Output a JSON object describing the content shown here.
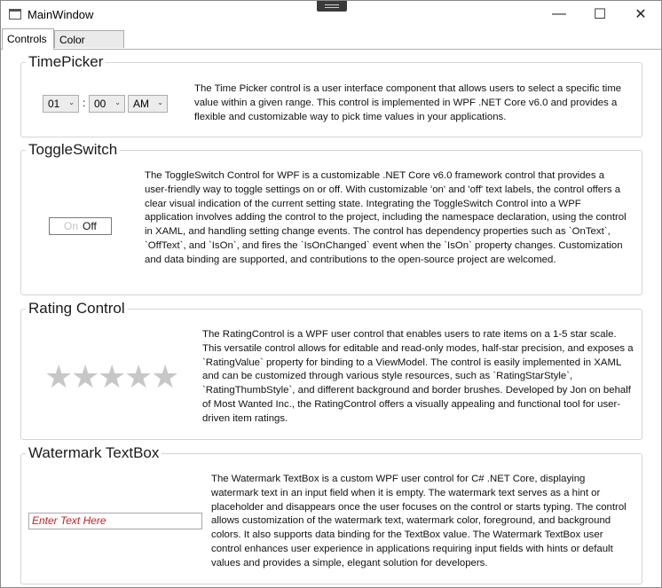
{
  "window": {
    "title": "MainWindow",
    "min_glyph": "—",
    "max_glyph": "☐",
    "close_glyph": "✕"
  },
  "tabs": [
    {
      "label": "Controls",
      "active": true
    },
    {
      "label": "Color Pickers",
      "active": false
    }
  ],
  "timepicker": {
    "title": "TimePicker",
    "hour": "01",
    "minute": "00",
    "ampm": "AM",
    "separator": ":",
    "description": "The Time Picker control is a user interface component that allows users to select a specific time value within a given range. This control is implemented in WPF .NET Core v6.0 and provides a flexible and customizable way to pick time values in your applications."
  },
  "toggleswitch": {
    "title": "ToggleSwitch",
    "on_label": "On",
    "off_label": "Off",
    "description": "The ToggleSwitch Control for WPF is a customizable .NET Core v6.0 framework control that provides a user-friendly way to toggle settings on or off. With customizable 'on' and 'off' text labels, the control offers a clear visual indication of the current setting state. Integrating the ToggleSwitch Control into a WPF application involves adding the control to the project, including the namespace declaration, using the control in XAML, and handling setting change events. The control has dependency properties such as `OnText`, `OffText`, and `IsOn`, and fires the `IsOnChanged` event when the `IsOn` property changes. Customization and data binding are supported, and contributions to the open-source project are welcomed."
  },
  "rating": {
    "title": "Rating Control",
    "stars": 5,
    "value": 0,
    "description": "The RatingControl is a WPF user control that enables users to rate items on a 1-5 star scale. This versatile control allows for editable and read-only modes, half-star precision, and exposes a `RatingValue` property for binding to a ViewModel. The control is easily implemented in XAML and can be customized through various style resources, such as `RatingStarStyle`, `RatingThumbStyle`, and different background and border brushes. Developed by Jon on behalf of Most Wanted Inc., the RatingControl offers a visually appealing and functional tool for user-driven item ratings."
  },
  "watermark": {
    "title": "Watermark TextBox",
    "placeholder": "Enter Text Here",
    "placeholder_color": "#d11a1a",
    "description": "The Watermark TextBox is a custom WPF user control for C# .NET Core, displaying watermark text in an input field when it is empty. The watermark text serves as a hint or placeholder and disappears once the user focuses on the control or starts typing. The control allows customization of the watermark text, watermark color, foreground, and background colors. It also supports data binding for the TextBox value. The Watermark TextBox user control enhances user experience in applications requiring input fields with hints or default values and provides a simple, elegant solution for developers."
  }
}
